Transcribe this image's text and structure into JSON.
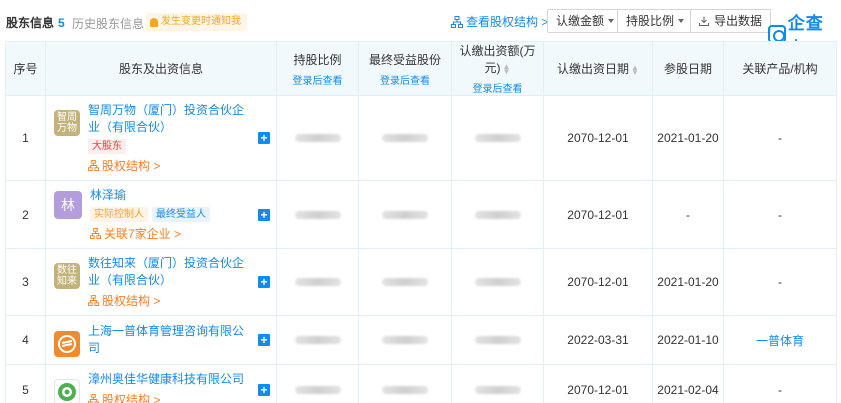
{
  "header": {
    "title": "股东信息",
    "title_count": "5",
    "history_label": "历史股东信息",
    "history_count": "1",
    "notice": "发生变更时通知我",
    "view_structure": "查看股权结构 >",
    "btn_amount": "认缴金额",
    "btn_ratio": "持股比例",
    "btn_export": "导出数据",
    "logo_text": "企查查"
  },
  "table": {
    "columns": {
      "no": "序号",
      "shareholder": "股东及出资信息",
      "ratio": "持股比例",
      "ratio_sub": "登录后查看",
      "final": "最终受益股份",
      "final_sub": "登录后查看",
      "amount": "认缴出资额(万元)",
      "amount_sub": "登录后查看",
      "date": "认缴出资日期",
      "join": "参股日期",
      "related": "关联产品/机构"
    },
    "rows": [
      {
        "no": "1",
        "avatar": "智周\n万物",
        "avatar_color": "#c4b27b",
        "name": "智周万物（厦门）投资合伙企业（有限合伙）",
        "tags": [
          {
            "text": "大股东",
            "style": "red"
          }
        ],
        "link": "股权结构 >",
        "date": "2070-12-01",
        "join": "2021-01-20",
        "related": "-"
      },
      {
        "no": "2",
        "avatar": "林",
        "avatar_color": "#b39ddb",
        "name": "林泽瑜",
        "tags": [
          {
            "text": "实际控制人",
            "style": "orange"
          },
          {
            "text": "最终受益人",
            "style": "blue"
          }
        ],
        "link": "关联7家企业 >",
        "date": "2070-12-01",
        "join": "-",
        "related": "-"
      },
      {
        "no": "3",
        "avatar": "数往\n知来",
        "avatar_color": "#c4b27b",
        "name": "数往知来（厦门）投资合伙企业（有限合伙）",
        "tags": [],
        "link": "股权结构 >",
        "date": "2070-12-01",
        "join": "2021-01-20",
        "related": "-"
      },
      {
        "no": "4",
        "avatar": "",
        "avatar_color": "#f08a2c",
        "name": "上海一普体育管理咨询有限公司",
        "tags": [],
        "link": "",
        "date": "2022-03-31",
        "join": "2022-01-10",
        "related": "一普体育"
      },
      {
        "no": "5",
        "avatar": "",
        "avatar_color": "#ffffff",
        "name": "漳州奥佳华健康科技有限公司",
        "tags": [],
        "link": "股权结构 >",
        "date": "2070-12-01",
        "join": "2021-02-04",
        "related": "-"
      }
    ]
  }
}
